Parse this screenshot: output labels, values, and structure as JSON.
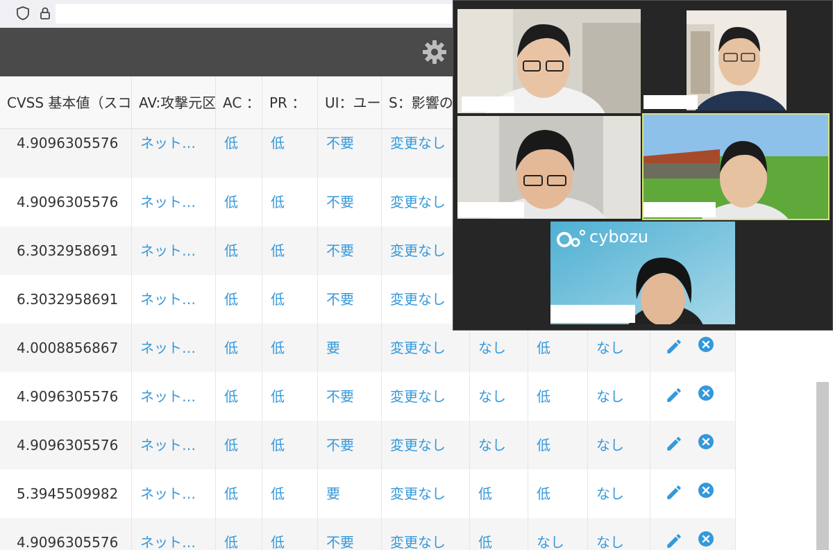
{
  "browser": {
    "icons": [
      "shield-icon",
      "lock-icon"
    ]
  },
  "header": {
    "icons": [
      "gear-icon"
    ]
  },
  "table": {
    "columns": [
      "CVSS 基本値（スコア）",
      "AV:攻撃元区分",
      "AC ：",
      "PR ：",
      "UI：ユーザ関与",
      "S：影響の想定範囲",
      "",
      "",
      "",
      ""
    ],
    "rows": [
      {
        "score": "4.9096305576",
        "av": "ネット…",
        "ac": "低",
        "pr": "低",
        "ui": "不要",
        "s": "変更なし",
        "c": "",
        "i": "",
        "a": ""
      },
      {
        "score": "4.9096305576",
        "av": "ネット…",
        "ac": "低",
        "pr": "低",
        "ui": "不要",
        "s": "変更なし",
        "c": "",
        "i": "",
        "a": ""
      },
      {
        "score": "6.3032958691",
        "av": "ネット…",
        "ac": "低",
        "pr": "低",
        "ui": "不要",
        "s": "変更なし",
        "c": "",
        "i": "",
        "a": ""
      },
      {
        "score": "6.3032958691",
        "av": "ネット…",
        "ac": "低",
        "pr": "低",
        "ui": "不要",
        "s": "変更なし",
        "c": "",
        "i": "",
        "a": ""
      },
      {
        "score": "4.0008856867",
        "av": "ネット…",
        "ac": "低",
        "pr": "低",
        "ui": "要",
        "s": "変更なし",
        "c": "なし",
        "i": "低",
        "a": "なし"
      },
      {
        "score": "4.9096305576",
        "av": "ネット…",
        "ac": "低",
        "pr": "低",
        "ui": "不要",
        "s": "変更なし",
        "c": "なし",
        "i": "低",
        "a": "なし"
      },
      {
        "score": "4.9096305576",
        "av": "ネット…",
        "ac": "低",
        "pr": "低",
        "ui": "不要",
        "s": "変更なし",
        "c": "なし",
        "i": "低",
        "a": "なし"
      },
      {
        "score": "5.3945509982",
        "av": "ネット…",
        "ac": "低",
        "pr": "低",
        "ui": "要",
        "s": "変更なし",
        "c": "低",
        "i": "低",
        "a": "なし"
      },
      {
        "score": "4.9096305576",
        "av": "ネット…",
        "ac": "低",
        "pr": "低",
        "ui": "不要",
        "s": "変更なし",
        "c": "低",
        "i": "なし",
        "a": "なし"
      }
    ],
    "row_actions": [
      "edit-pencil-icon",
      "delete-x-icon"
    ]
  },
  "video_call": {
    "logo_text": "cybozu",
    "participant_count": 5
  },
  "colors": {
    "link": "#3498db",
    "header_bg": "#4a4a4a",
    "overlay_bg": "#262626",
    "active_speaker_border": "#d8e27a"
  }
}
